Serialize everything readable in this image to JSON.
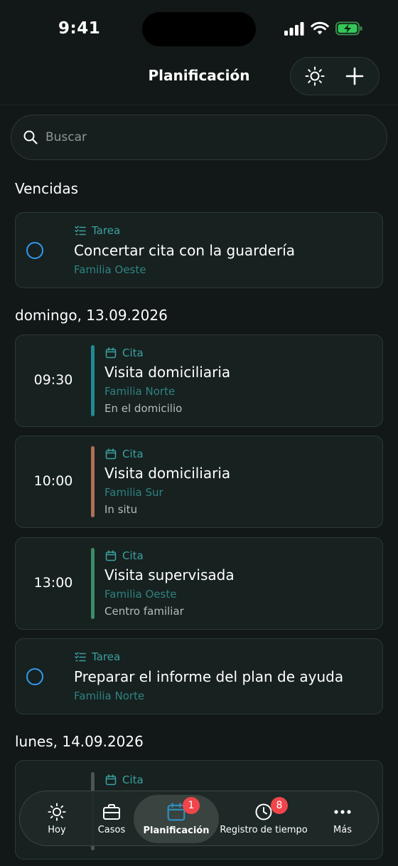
{
  "status_bar": {
    "time": "9:41"
  },
  "header": {
    "title": "Planificación"
  },
  "search": {
    "placeholder": "Buscar"
  },
  "sections": {
    "overdue": "Vencidas",
    "sunday": "domingo, 13.09.2026",
    "monday": "lunes, 14.09.2026"
  },
  "overdue_task": {
    "kind": "Tarea",
    "title": "Concertar cita con la guardería",
    "family": "Familia Oeste"
  },
  "sunday_items": [
    {
      "kind": "Cita",
      "time": "09:30",
      "title": "Visita domiciliaria",
      "family": "Familia Norte",
      "location": "En el domicilio",
      "color": "#1f8a92"
    },
    {
      "kind": "Cita",
      "time": "10:00",
      "title": "Visita domiciliaria",
      "family": "Familia Sur",
      "location": "In situ",
      "color": "#b06f58"
    },
    {
      "kind": "Cita",
      "time": "13:00",
      "title": "Visita supervisada",
      "family": "Familia Oeste",
      "location": "Centro familiar",
      "color": "#3b8d66"
    }
  ],
  "sunday_task": {
    "kind": "Tarea",
    "title": "Preparar el informe del plan de ayuda",
    "family": "Familia Norte"
  },
  "monday_items": [
    {
      "kind": "Cita"
    }
  ],
  "tabs": [
    {
      "label": "Hoy"
    },
    {
      "label": "Casos"
    },
    {
      "label": "Planificación",
      "badge": "1"
    },
    {
      "label": "Registro de tiempo",
      "badge": "8"
    },
    {
      "label": "Más"
    }
  ]
}
